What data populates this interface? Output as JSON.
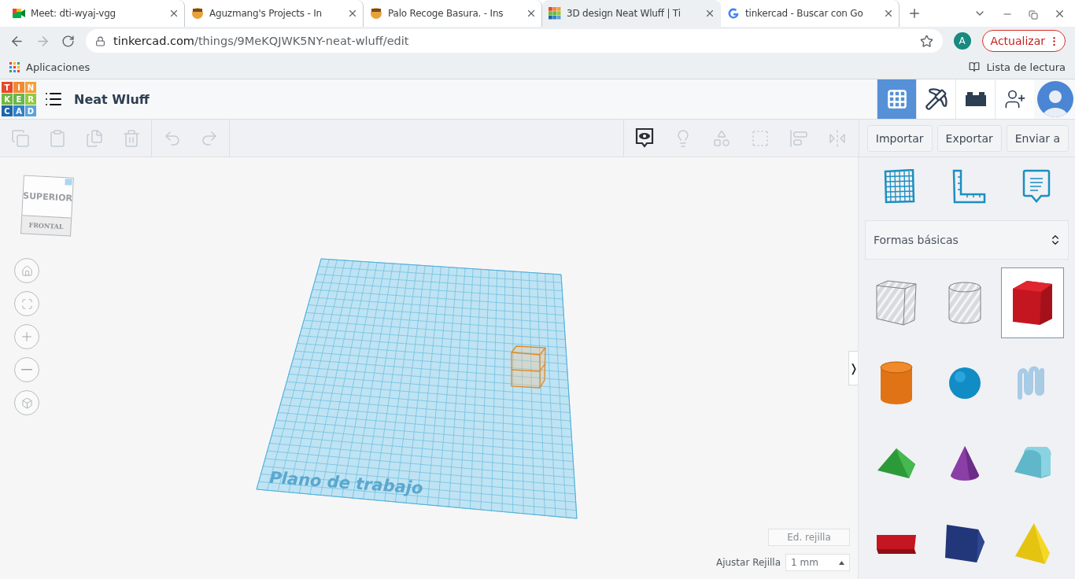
{
  "browser": {
    "tabs": [
      {
        "kind": "meet",
        "title": "Meet: dti-wyaj-vgg",
        "selected": false
      },
      {
        "kind": "avatar",
        "title": "Aguzmang's Projects - In",
        "selected": false
      },
      {
        "kind": "avatar",
        "title": "Palo Recoge Basura. - Ins",
        "selected": false
      },
      {
        "kind": "tinkercad",
        "title": "3D design Neat Wluff | Ti",
        "selected": true
      },
      {
        "kind": "google",
        "title": "tinkercad - Buscar con Go",
        "selected": false
      }
    ],
    "url_host": "tinkercad.com",
    "url_path": "/things/9MeKQJWK5NY-neat-wluff/edit",
    "profile_initial": "A",
    "update_button": "Actualizar",
    "bookmarks": [
      {
        "label": "Aplicaciones"
      }
    ],
    "reading_list": "Lista de lectura"
  },
  "app": {
    "logo_letters": [
      "T",
      "I",
      "N",
      "K",
      "E",
      "R",
      "C",
      "A",
      "D"
    ],
    "design_title": "Neat Wluff",
    "views": [
      {
        "kind": "grid",
        "selected": true
      },
      {
        "kind": "pickaxe",
        "selected": false
      },
      {
        "kind": "bricks",
        "selected": false
      }
    ],
    "toolbar": [
      {
        "kind": "copy",
        "disabled": true
      },
      {
        "kind": "paste",
        "disabled": true
      },
      {
        "kind": "duplicate",
        "disabled": true
      },
      {
        "kind": "delete",
        "disabled": true
      },
      {
        "kind": "undo",
        "disabled": true
      },
      {
        "kind": "redo",
        "disabled": true
      }
    ],
    "toolbar_right": [
      {
        "kind": "notes",
        "disabled": false
      },
      {
        "kind": "bulb",
        "disabled": true
      },
      {
        "kind": "group",
        "disabled": true
      },
      {
        "kind": "ungroup",
        "disabled": true
      },
      {
        "kind": "align",
        "disabled": true
      },
      {
        "kind": "mirror",
        "disabled": true
      }
    ],
    "actions": [
      "Importar",
      "Exportar",
      "Enviar a"
    ],
    "view_cube": {
      "top": "SUPERIOR",
      "front": "FRONTAL"
    },
    "workplane_label": "Plano de trabajo",
    "edit_grid": "Ed. rejilla",
    "snap_label": "Ajustar Rejilla",
    "snap_value": "1 mm",
    "panel_toggle": "❭",
    "panel_tools": [
      {
        "kind": "workplane"
      },
      {
        "kind": "ruler"
      },
      {
        "kind": "note"
      }
    ],
    "library": "Formas básicas",
    "shapes": [
      {
        "kind": "box-hole",
        "selected": false
      },
      {
        "kind": "cylinder-hole",
        "selected": false
      },
      {
        "kind": "box",
        "selected": true
      },
      {
        "kind": "cylinder",
        "selected": false
      },
      {
        "kind": "sphere",
        "selected": false
      },
      {
        "kind": "scribble",
        "selected": false
      },
      {
        "kind": "roof",
        "selected": false
      },
      {
        "kind": "cone",
        "selected": false
      },
      {
        "kind": "round-roof",
        "selected": false
      },
      {
        "kind": "text",
        "selected": false
      },
      {
        "kind": "prism",
        "selected": false
      },
      {
        "kind": "pyramid",
        "selected": false
      }
    ]
  }
}
